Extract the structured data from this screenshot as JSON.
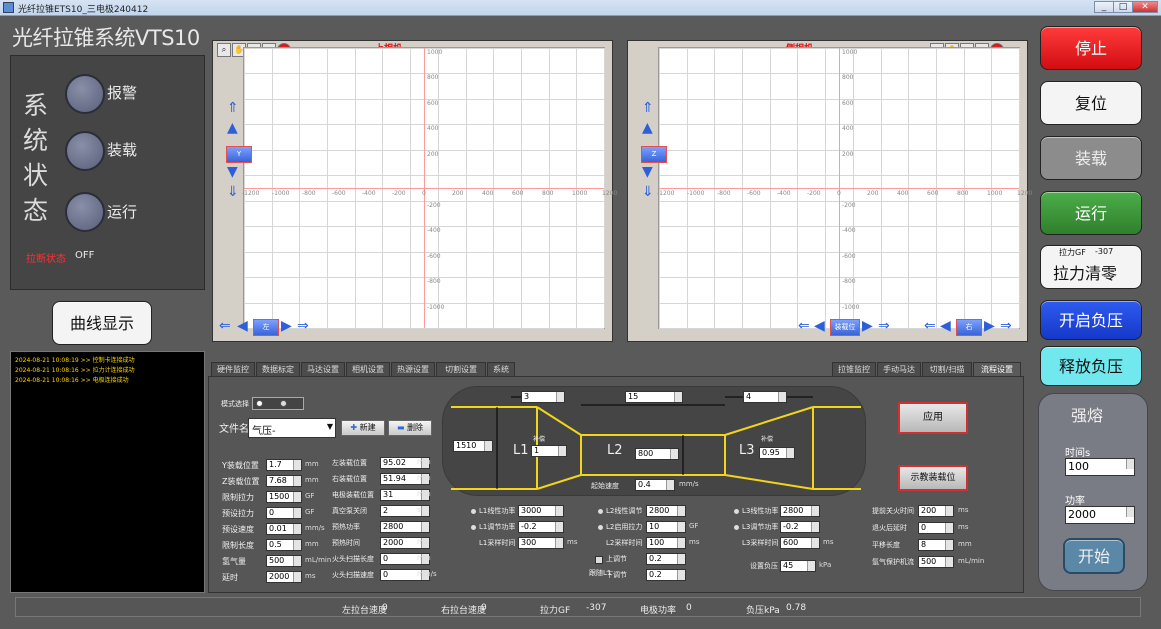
{
  "window": {
    "title": "光纤拉锥ETS10_三电极240412",
    "controls": [
      "_",
      "□",
      "✕"
    ]
  },
  "app": {
    "title": "光纤拉锥系统VTS10"
  },
  "status": {
    "chars": [
      "系",
      "统",
      "状",
      "态"
    ],
    "leds": [
      "报警",
      "装载",
      "运行"
    ],
    "pull_state_label": "拉断状态",
    "pull_state_value": "OFF"
  },
  "curve_button": "曲线显示",
  "top_cam": {
    "title": "上相机",
    "y_label": "Y",
    "dir_label": "左",
    "x_ticks": [
      "-1200",
      "-1000",
      "-800",
      "-600",
      "-400",
      "-200",
      "0",
      "200",
      "400",
      "600",
      "800",
      "1000",
      "1200"
    ],
    "y_ticks": [
      "1000",
      "800",
      "600",
      "400",
      "200",
      "-200",
      "-400",
      "-600",
      "-800",
      "-1000"
    ]
  },
  "side_cam": {
    "title": "侧相机",
    "z_label": "Z",
    "load_label": "装载位",
    "dir_label": "右",
    "x_ticks": [
      "-1200",
      "-1000",
      "-800",
      "-600",
      "-400",
      "-200",
      "0",
      "200",
      "400",
      "600",
      "800",
      "1000",
      "1200"
    ],
    "y_ticks": [
      "1000",
      "800",
      "600",
      "400",
      "200",
      "-200",
      "-400",
      "-600",
      "-800",
      "-1000"
    ]
  },
  "right_buttons": {
    "stop": "停止",
    "reset": "复位",
    "load": "装载",
    "run": "运行",
    "tension_gf_label": "拉力GF",
    "tension_gf_value": "-307",
    "tension_zero": "拉力清零",
    "open_neg": "开启负压",
    "release_neg": "释放负压"
  },
  "melt": {
    "title": "强熔",
    "time_label": "时间s",
    "time_value": "100",
    "power_label": "功率",
    "power_value": "2000",
    "start": "开始"
  },
  "log": [
    "2024-08-21 10:08:19  >>  控制卡连接成功",
    "2024-08-21 10:08:16  >>  拉力计连接成功",
    "2024-08-21 10:08:16  >>  电极连接成功"
  ],
  "tabs_left": [
    "硬件监控",
    "数据标定",
    "马达设置",
    "相机设置",
    "热源设置",
    "切割设置",
    "系统"
  ],
  "tabs_right": [
    "拉锥监控",
    "手动马达",
    "切割/扫描",
    "流程设置"
  ],
  "form": {
    "mode_label": "模式选择",
    "mode_a": "",
    "mode_b": "",
    "file_label": "文件名",
    "file_value": "气压-",
    "new": "新建",
    "delete": "删除",
    "left": [
      {
        "l": "Y装载位置",
        "v": "1.7",
        "u": "mm"
      },
      {
        "l": "Z装载位置",
        "v": "7.68",
        "u": "mm"
      },
      {
        "l": "限制拉力",
        "v": "1500",
        "u": "GF"
      },
      {
        "l": "预设拉力",
        "v": "0",
        "u": "GF"
      },
      {
        "l": "预设速度",
        "v": "0.01",
        "u": "mm/s"
      },
      {
        "l": "限制长度",
        "v": "0.5",
        "u": "mm"
      },
      {
        "l": "氢气量",
        "v": "500",
        "u": "mL/min"
      },
      {
        "l": "延时",
        "v": "2000",
        "u": "ms"
      }
    ],
    "mid": [
      {
        "l": "左装载位置",
        "v": "95.02",
        "u": "mm"
      },
      {
        "l": "右装载位置",
        "v": "51.94",
        "u": "mm"
      },
      {
        "l": "电极装载位置",
        "v": "31",
        "u": "mm"
      },
      {
        "l": "真空泵关闭",
        "v": "2",
        "u": "s"
      },
      {
        "l": "预热功率",
        "v": "2800",
        "u": ""
      },
      {
        "l": "预热时间",
        "v": "2000",
        "u": "ms"
      },
      {
        "l": "火头扫描长度",
        "v": "0",
        "u": "mm"
      },
      {
        "l": "火头扫描速度",
        "v": "0",
        "u": "mm/s"
      }
    ],
    "diagram": {
      "top_l": "3",
      "top_m": "15",
      "top_r": "4",
      "left_h": "1510",
      "l1": "L1",
      "l2": "L2",
      "l3": "L3",
      "comp1_label": "补偿",
      "comp1": "1",
      "comp3_label": "补偿",
      "comp3": "0.95",
      "mid_h": "800",
      "speed_label": "起始速度",
      "speed": "0.4",
      "speed_unit": "mm/s"
    },
    "l1": [
      {
        "l": "L1线性功率",
        "v": "3000",
        "u": ""
      },
      {
        "l": "L1调节功率",
        "v": "-0.2",
        "u": ""
      },
      {
        "l": "L1采样时间",
        "v": "300",
        "u": "ms"
      }
    ],
    "l2": [
      {
        "l": "L2线性调节",
        "v": "2800",
        "u": ""
      },
      {
        "l": "L2启用拉力",
        "v": "10",
        "u": "GF"
      },
      {
        "l": "L2采样时间",
        "v": "100",
        "u": "ms"
      },
      {
        "l": "上调节",
        "v": "0.2",
        "u": ""
      },
      {
        "l": "下调节",
        "v": "0.2",
        "u": ""
      }
    ],
    "l3": [
      {
        "l": "L3线性功率",
        "v": "2800",
        "u": ""
      },
      {
        "l": "L3调节功率",
        "v": "-0.2",
        "u": ""
      },
      {
        "l": "L3采样时间",
        "v": "600",
        "u": "ms"
      }
    ],
    "follow": "跟随L1",
    "neg": {
      "l": "设置负压",
      "v": "45",
      "u": "kPa"
    },
    "right": [
      {
        "l": "提前关火时间",
        "v": "200",
        "u": "ms"
      },
      {
        "l": "退火后延时",
        "v": "0",
        "u": "ms"
      },
      {
        "l": "平移长度",
        "v": "8",
        "u": "mm"
      },
      {
        "l": "氩气保护机流",
        "v": "500",
        "u": "mL/min"
      }
    ],
    "apply": "应用",
    "demo": "示教装载位"
  },
  "statusbar": [
    {
      "l": "左拉台速度",
      "v": "0"
    },
    {
      "l": "右拉台速度",
      "v": "0"
    },
    {
      "l": "拉力GF",
      "v": "-307"
    },
    {
      "l": "电极功率",
      "v": "0"
    },
    {
      "l": "负压kPa",
      "v": "0.78"
    }
  ],
  "colors": {
    "stop": "#e8141c",
    "reset": "#f4f4f4",
    "load": "#8c8c8c",
    "run": "#3d9a3a",
    "open_neg": "#1e44d8",
    "release_neg": "#70e8ee"
  }
}
